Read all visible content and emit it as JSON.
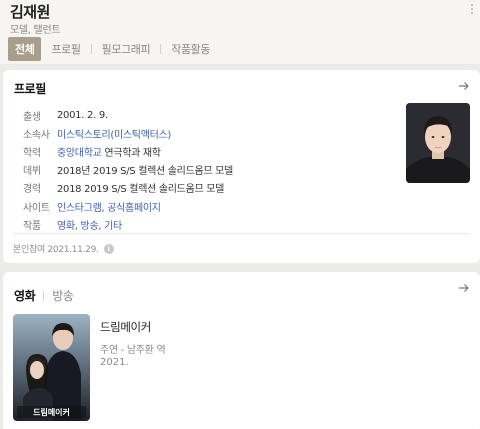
{
  "header": {
    "name": "김재원",
    "subtitle": "모델, 탤런트"
  },
  "tabs": [
    "전체",
    "프로필",
    "필모그래피",
    "작품활동"
  ],
  "profile": {
    "title": "프로필",
    "rows": [
      {
        "label": "출생",
        "value": "2001. 2. 9."
      },
      {
        "label": "소속사",
        "value": "미스틱스토리(미스틱액터스)"
      },
      {
        "label": "학력",
        "link": "중앙대학교",
        "rest": " 연극학과 재학"
      },
      {
        "label": "데뷔",
        "value": "2018년 2019 S/S 컬렉션 솔리드옴므 모델"
      },
      {
        "label": "경력",
        "value": "2018 2019 S/S 컬렉션 솔리드옴므 모델"
      },
      {
        "label": "사이트",
        "value": "인스타그램, 공식홈페이지"
      },
      {
        "label": "작품",
        "value": "영화, 방송, 기타"
      }
    ],
    "self_checked": "본인참여 2021.11.29."
  },
  "works": {
    "tabs": [
      "영화",
      "방송"
    ],
    "item": {
      "title": "드림메이커",
      "role": "주연 - 남주환 역",
      "year": "2021.",
      "poster_text": "드림메이커"
    }
  },
  "colors": {
    "accent_tab": "#a89e8c",
    "link": "#3d61b5",
    "background": "#ecebe8"
  }
}
